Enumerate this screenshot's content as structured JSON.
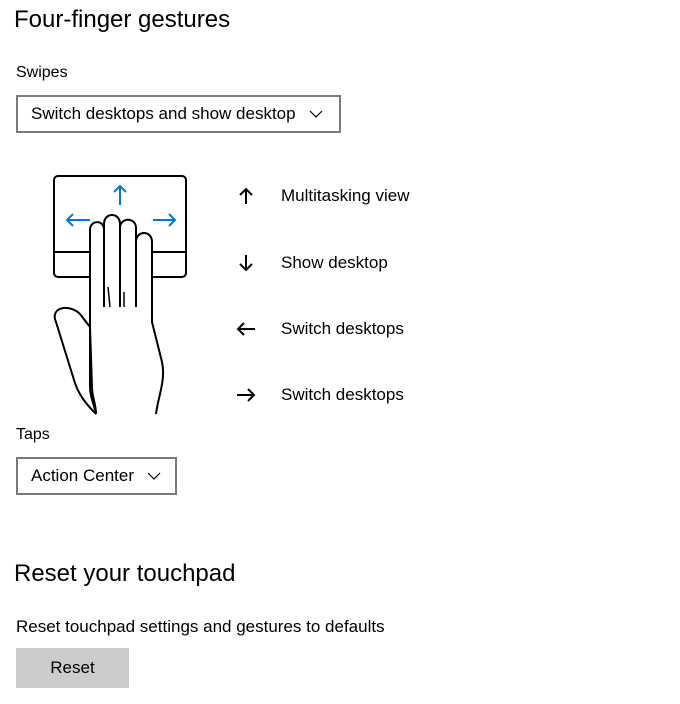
{
  "four_finger": {
    "title": "Four-finger gestures",
    "swipes_label": "Swipes",
    "swipes_value": "Switch desktops and show desktop",
    "gestures": [
      {
        "icon": "arrow-up-icon",
        "label": "Multitasking view"
      },
      {
        "icon": "arrow-down-icon",
        "label": "Show desktop"
      },
      {
        "icon": "arrow-left-icon",
        "label": "Switch desktops"
      },
      {
        "icon": "arrow-right-icon",
        "label": "Switch desktops"
      }
    ],
    "taps_label": "Taps",
    "taps_value": "Action Center"
  },
  "reset": {
    "title": "Reset your touchpad",
    "description": "Reset touchpad settings and gestures to defaults",
    "button_label": "Reset"
  },
  "colors": {
    "accent": "#0078d7",
    "dropdown_border": "#7a7a7a",
    "button_bg": "#cccccc"
  }
}
